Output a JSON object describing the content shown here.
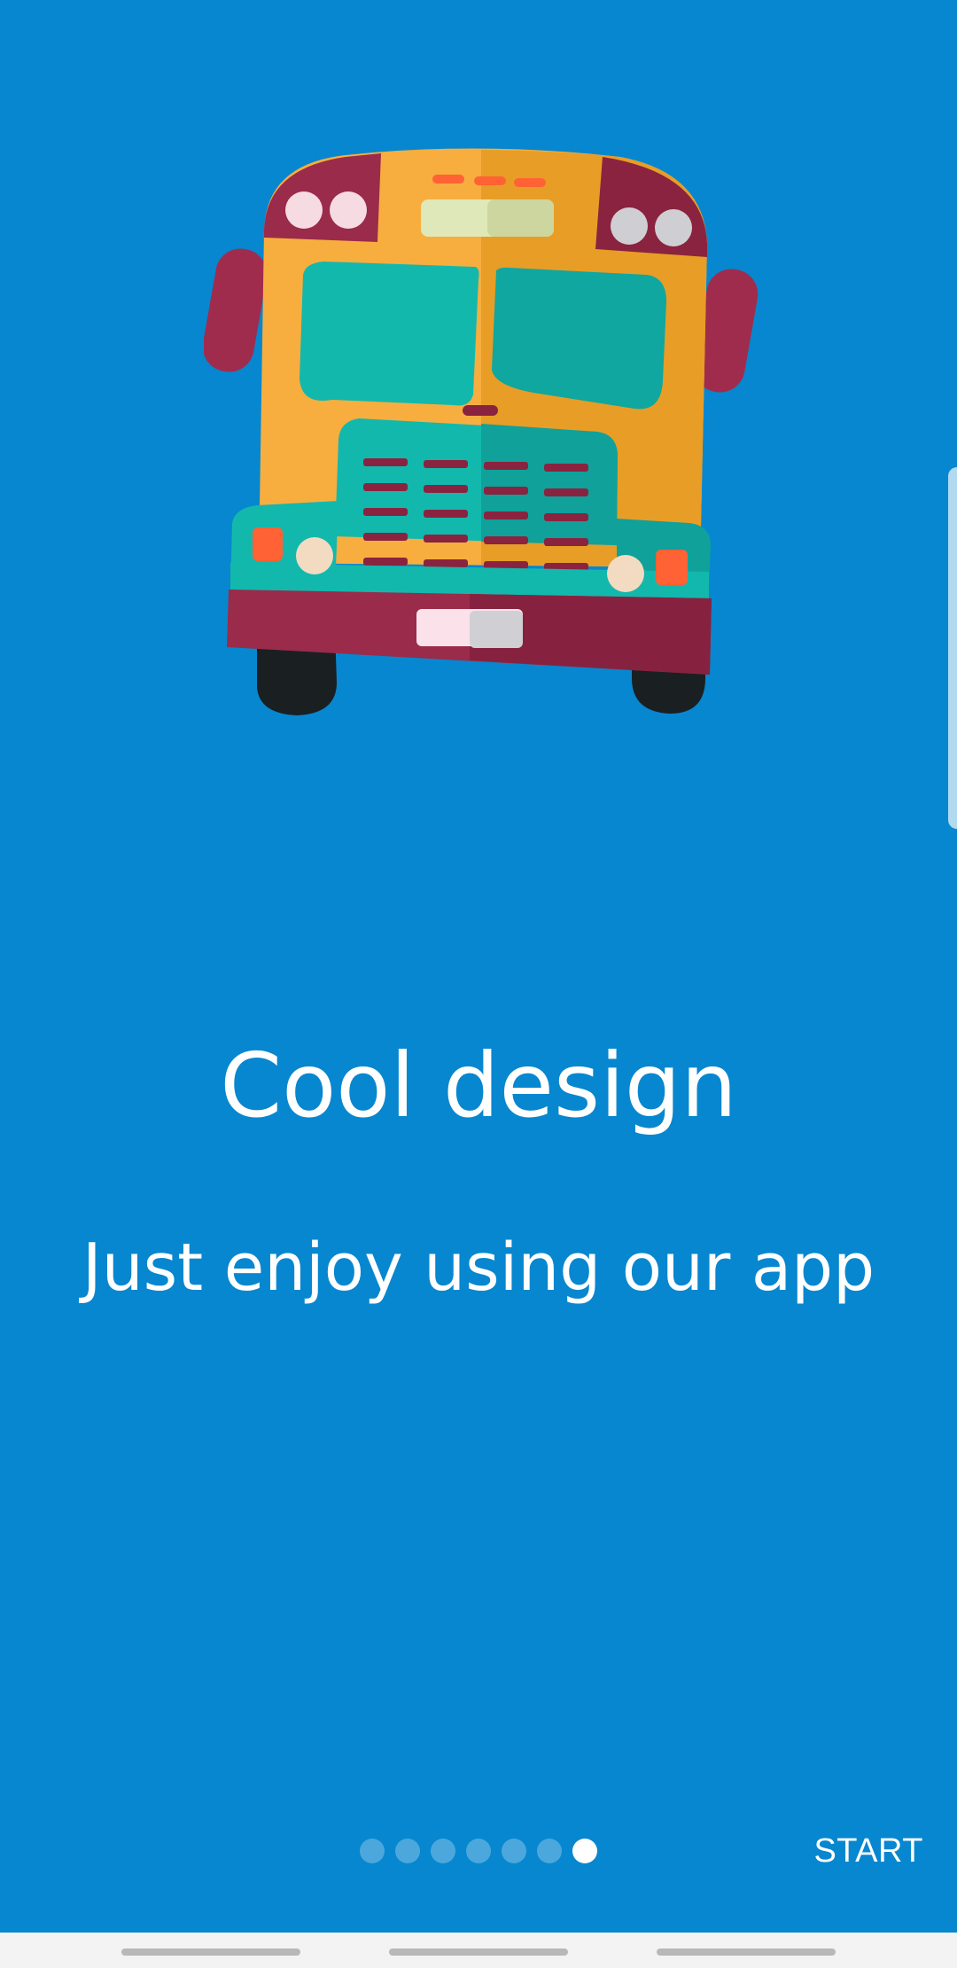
{
  "onboarding": {
    "title": "Cool design",
    "subtitle": "Just enjoy using our app",
    "page_count": 7,
    "current_page": 7,
    "start_label": "START"
  },
  "illustration": {
    "icon": "school-bus-icon"
  },
  "colors": {
    "background": "#0787cf",
    "text": "#ffffff",
    "bus_body": "#f7ae3f",
    "bus_accent": "#9a2b4a",
    "bus_window": "#13b8ad"
  },
  "system_nav": {
    "items": [
      "recents-button",
      "home-button",
      "back-button"
    ]
  }
}
